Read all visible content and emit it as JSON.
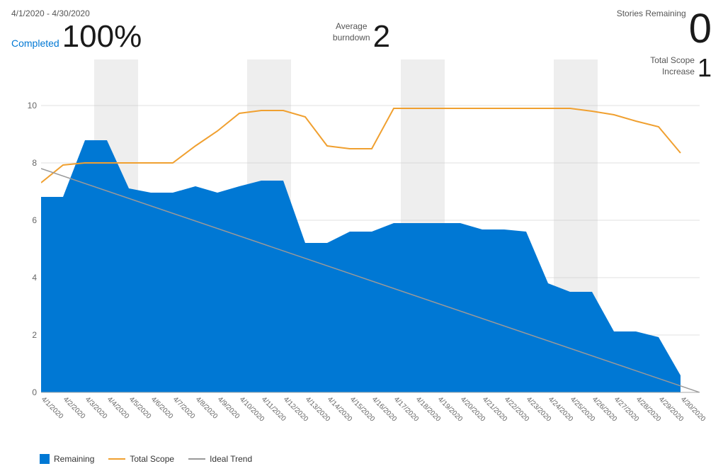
{
  "header": {
    "date_range": "4/1/2020 - 4/30/2020"
  },
  "metrics": {
    "completed_label": "Completed",
    "completed_value": "100%",
    "avg_burndown_label": "Average\nburndown",
    "avg_burndown_value": "2",
    "stories_remaining_label": "Stories\nRemaining",
    "stories_remaining_value": "0",
    "total_scope_label": "Total Scope\nIncrease",
    "total_scope_value": "1"
  },
  "legend": {
    "remaining_label": "Remaining",
    "total_scope_label": "Total Scope",
    "ideal_trend_label": "Ideal Trend"
  },
  "chart": {
    "y_axis": [
      0,
      2,
      4,
      6,
      8,
      10
    ],
    "x_labels": [
      "4/1/2020",
      "4/2/2020",
      "4/3/2020",
      "4/4/2020",
      "4/5/2020",
      "4/6/2020",
      "4/7/2020",
      "4/8/2020",
      "4/9/2020",
      "4/10/2020",
      "4/11/2020",
      "4/12/2020",
      "4/13/2020",
      "4/14/2020",
      "4/15/2020",
      "4/16/2020",
      "4/17/2020",
      "4/18/2020",
      "4/19/2020",
      "4/20/2020",
      "4/21/2020",
      "4/22/2020",
      "4/23/2020",
      "4/24/2020",
      "4/25/2020",
      "4/26/2020",
      "4/27/2020",
      "4/28/2020",
      "4/29/2020",
      "4/30/2020"
    ]
  },
  "colors": {
    "remaining_fill": "#0078d4",
    "total_scope_line": "#f0a030",
    "ideal_trend_line": "#808080",
    "weekend_shade": "rgba(200,200,200,0.4)",
    "grid_line": "#e0e0e0"
  }
}
